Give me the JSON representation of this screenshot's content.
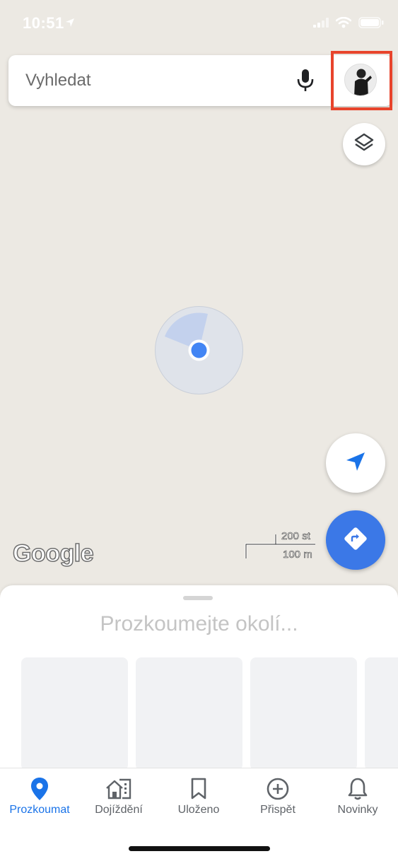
{
  "status_bar": {
    "time": "10:51"
  },
  "search": {
    "placeholder": "Vyhledat"
  },
  "map": {
    "attribution": "Google",
    "scale_top": "200 st",
    "scale_bottom": "100 m"
  },
  "sheet": {
    "title": "Prozkoumejte okolí..."
  },
  "nav": {
    "items": [
      {
        "label": "Prozkoumat",
        "icon": "pin-icon",
        "active": true
      },
      {
        "label": "Dojíždění",
        "icon": "commute-icon",
        "active": false
      },
      {
        "label": "Uloženo",
        "icon": "bookmark-icon",
        "active": false
      },
      {
        "label": "Přispět",
        "icon": "add-circle-icon",
        "active": false
      },
      {
        "label": "Novinky",
        "icon": "bell-icon",
        "active": false
      }
    ]
  },
  "colors": {
    "accent": "#1a73e8",
    "directions": "#3b78e7",
    "highlight_frame": "#e8442c"
  }
}
